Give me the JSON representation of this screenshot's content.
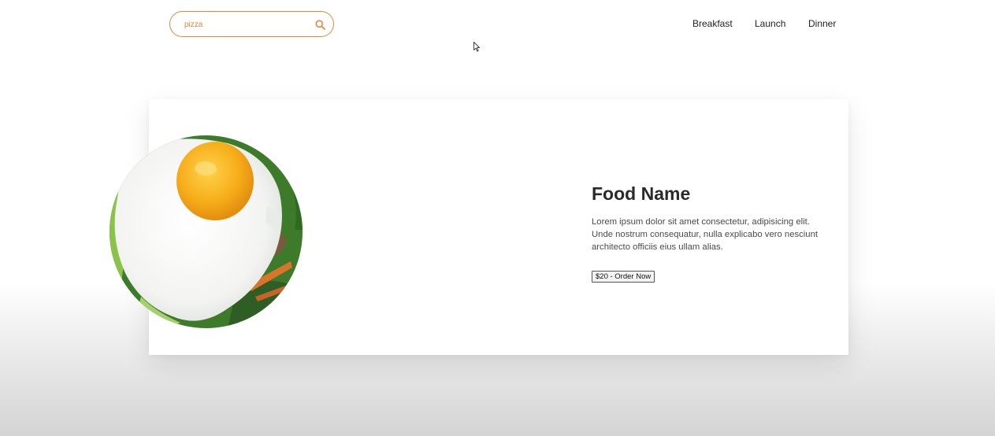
{
  "search": {
    "value": "pizza",
    "icon": "search-icon"
  },
  "nav": {
    "items": [
      {
        "label": "Breakfast"
      },
      {
        "label": "Launch"
      },
      {
        "label": "Dinner"
      }
    ]
  },
  "card": {
    "image_icon": "fried-egg-food-image",
    "title": "Food Name",
    "description": "Lorem ipsum dolor sit amet consectetur, adipisicing elit. Unde nostrum consequatur, nulla explicabo vero nesciunt architecto officiis eius ullam alias.",
    "button_label": "$20 - Order Now"
  },
  "colors": {
    "accent": "#e0893a",
    "text": "#2a2a2a",
    "background": "#ffffff"
  }
}
